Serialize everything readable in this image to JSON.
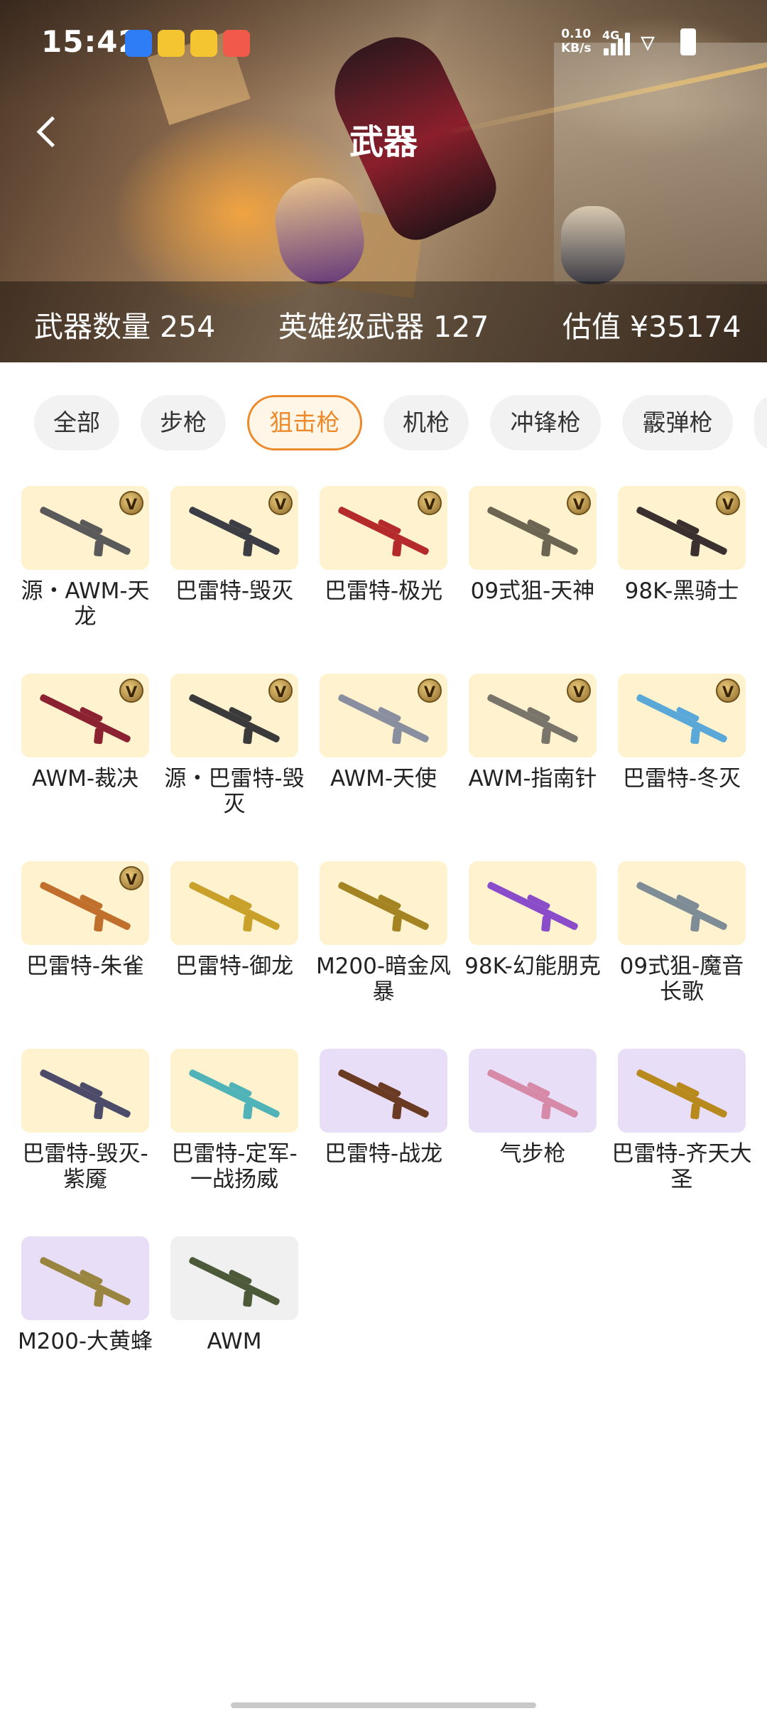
{
  "status_bar": {
    "time": "15:42",
    "app_icons": [
      {
        "icon": "blue-app-icon",
        "text": "",
        "color": "#2f7df6"
      },
      {
        "icon": "yellow-app-icon",
        "text": "",
        "color": "#f4c531"
      },
      {
        "icon": "yellow-app-icon-2",
        "text": "",
        "color": "#f4c531"
      },
      {
        "icon": "red-app-icon",
        "text": "",
        "color": "#f15a4a"
      }
    ],
    "net_speed": "0.10",
    "net_unit": "KB/s",
    "network_type": "4G"
  },
  "header": {
    "title": "武器"
  },
  "stats": {
    "weapon_count_label": "武器数量",
    "weapon_count": "254",
    "hero_weapon_label": "英雄级武器",
    "hero_weapon_count": "127",
    "value_label": "估值",
    "value": "¥35174"
  },
  "tabs": [
    {
      "label": "全部"
    },
    {
      "label": "步枪"
    },
    {
      "label": "狙击枪",
      "active": true
    },
    {
      "label": "机枪"
    },
    {
      "label": "冲锋枪"
    },
    {
      "label": "霰弹枪"
    }
  ],
  "weapons": [
    {
      "name": "源・AWM-天龙",
      "bg": "gold",
      "hero": true,
      "color": "#5a5a5a"
    },
    {
      "name": "巴雷特-毁灭",
      "bg": "gold",
      "hero": true,
      "color": "#3d3d45"
    },
    {
      "name": "巴雷特-极光",
      "bg": "gold",
      "hero": true,
      "color": "#b52a2a"
    },
    {
      "name": "09式狙-天神",
      "bg": "gold",
      "hero": true,
      "color": "#6b6552"
    },
    {
      "name": "98K-黑骑士",
      "bg": "gold",
      "hero": true,
      "color": "#3a3030"
    },
    {
      "name": "AWM-裁决",
      "bg": "gold",
      "hero": true,
      "color": "#8a2231"
    },
    {
      "name": "源・巴雷特-毁灭",
      "bg": "gold",
      "hero": true,
      "color": "#3a3a3a"
    },
    {
      "name": "AWM-天使",
      "bg": "gold",
      "hero": true,
      "color": "#8a8fa0"
    },
    {
      "name": "AWM-指南针",
      "bg": "gold",
      "hero": true,
      "color": "#7a756a"
    },
    {
      "name": "巴雷特-冬灭",
      "bg": "gold",
      "hero": true,
      "color": "#5aa8d8"
    },
    {
      "name": "巴雷特-朱雀",
      "bg": "gold",
      "hero": true,
      "color": "#c0702c"
    },
    {
      "name": "巴雷特-御龙",
      "bg": "gold",
      "hero": false,
      "color": "#c9a12a"
    },
    {
      "name": "M200-暗金风暴",
      "bg": "gold",
      "hero": false,
      "color": "#a48322"
    },
    {
      "name": "98K-幻能朋克",
      "bg": "gold",
      "hero": false,
      "color": "#8a4cc8"
    },
    {
      "name": "09式狙-魔音长歌",
      "bg": "gold",
      "hero": false,
      "color": "#7e8c96"
    },
    {
      "name": "巴雷特-毁灭-紫魇",
      "bg": "gold",
      "hero": false,
      "color": "#4c4c6a"
    },
    {
      "name": "巴雷特-定军-一战扬威",
      "bg": "gold",
      "hero": false,
      "color": "#4fb3b8"
    },
    {
      "name": "巴雷特-战龙",
      "bg": "purple",
      "hero": false,
      "color": "#6b3a22"
    },
    {
      "name": "气步枪",
      "bg": "purple",
      "hero": false,
      "color": "#d68aa8"
    },
    {
      "name": "巴雷特-齐天大圣",
      "bg": "purple",
      "hero": false,
      "color": "#b88a1e"
    },
    {
      "name": "M200-大黄蜂",
      "bg": "purple",
      "hero": false,
      "color": "#9a8540"
    },
    {
      "name": "AWM",
      "bg": "gray",
      "hero": false,
      "color": "#4d5a3a"
    }
  ],
  "hero_badge_letter": "V"
}
